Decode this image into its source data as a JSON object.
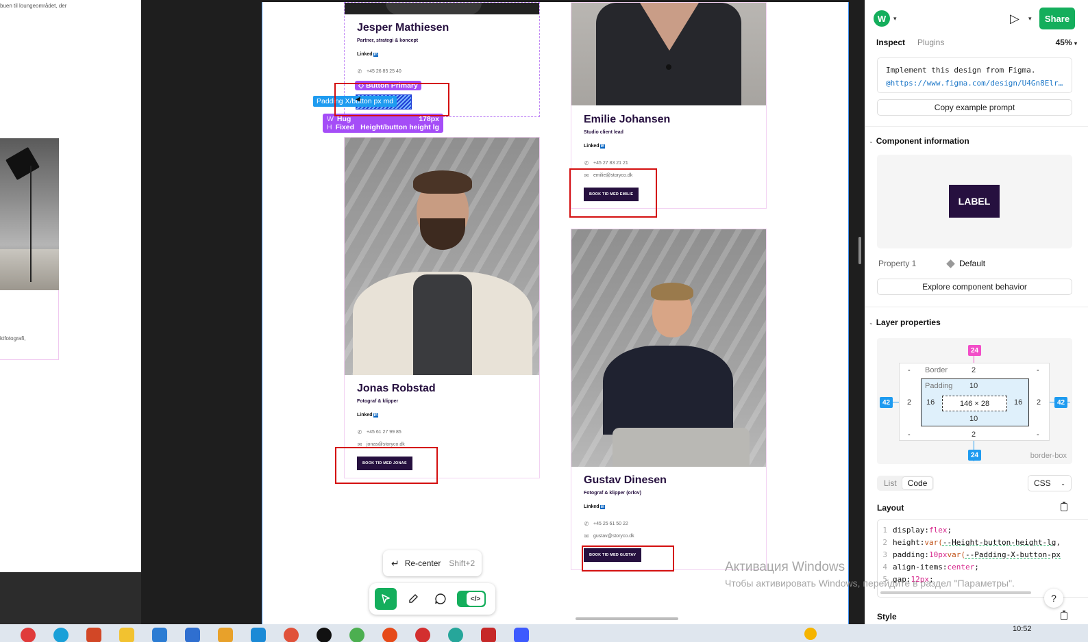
{
  "canvas": {
    "left_snippet_top": "buen til loungeområdet, der",
    "left_snippet_bottom": "ktfotografi,",
    "annotations": {
      "component_tag": "Button Primary",
      "padding_tag": "Padding X/button px md",
      "size_w_key": "W",
      "size_w_mode": "Hug",
      "size_w_value": "178px",
      "size_h_key": "H",
      "size_h_mode": "Fixed",
      "size_h_value": "Height/button height lg"
    },
    "cards": [
      {
        "name": "Jesper Mathiesen",
        "role": "Partner, strategi & koncept",
        "linkedin": "Linked",
        "linkedin_badge": "in",
        "phone": "+45 26 85 25 40",
        "email": "",
        "button": ""
      },
      {
        "name": "Emilie Johansen",
        "role": "Studio client lead",
        "linkedin": "Linked",
        "linkedin_badge": "in",
        "phone": "+45 27 83 21 21",
        "email": "emilie@storyco.dk",
        "button": "BOOK TID MED EMILIE"
      },
      {
        "name": "Jonas Robstad",
        "role": "Fotograf & klipper",
        "linkedin": "Linked",
        "linkedin_badge": "in",
        "phone": "+45 61 27 99 85",
        "email": "jonas@storyco.dk",
        "button": "BOOK TID MED JONAS"
      },
      {
        "name": "Gustav Dinesen",
        "role": "Fotograf & klipper (orlov)",
        "linkedin": "Linked",
        "linkedin_badge": "in",
        "phone": "+45 25 61 50 22",
        "email": "gustav@storyco.dk",
        "button": "BOOK TID MED GUSTAV"
      }
    ],
    "recenter": {
      "label": "Re-center",
      "shortcut": "Shift+2"
    },
    "watermark": {
      "line1": "Активация Windows",
      "line2": "Чтобы активировать Windows, перейдите в раздел \"Параметры\"."
    }
  },
  "panel": {
    "avatar_letter": "W",
    "share_label": "Share",
    "tabs": [
      {
        "label": "Inspect",
        "active": true
      },
      {
        "label": "Plugins",
        "active": false
      }
    ],
    "zoom": "45%",
    "prompt_line1": "Implement this design from Figma.",
    "prompt_line2": "@https://www.figma.com/design/U4Gn8Elr…",
    "copy_prompt_label": "Copy example prompt",
    "component_section": "Component information",
    "component_preview_label": "LABEL",
    "property_name": "Property 1",
    "property_value": "Default",
    "explore_label": "Explore component behavior",
    "layer_section": "Layer properties",
    "box_model": {
      "margin_top": "24",
      "margin_bottom": "24",
      "margin_left": "42",
      "margin_right": "42",
      "border_label": "Border",
      "border_top": "2",
      "border_bottom": "2",
      "border_left": "2",
      "border_right": "2",
      "padding_label": "Padding",
      "padding_top": "10",
      "padding_bottom": "10",
      "padding_left": "16",
      "padding_right": "16",
      "content_size": "146 × 28",
      "dash": "-",
      "box_sizing": "border-box"
    },
    "view_modes": [
      "List",
      "Code"
    ],
    "active_view": "Code",
    "language": "CSS",
    "layout_section": "Layout",
    "code_lines": [
      {
        "n": "1",
        "prop": "display: ",
        "val": "flex",
        "rest": ";"
      },
      {
        "n": "2",
        "prop": "height: ",
        "fn": "var(",
        "var": "--Height-button-height-lg",
        "rest": ","
      },
      {
        "n": "3",
        "prop": "padding: ",
        "val": "10px ",
        "fn": "var(",
        "var": "--Padding-X-button-px",
        "rest": ""
      },
      {
        "n": "4",
        "prop": "align-items: ",
        "val": "center",
        "rest": ";"
      },
      {
        "n": "5",
        "prop": "gap: ",
        "val": "12px",
        "rest": ";"
      }
    ],
    "style_section": "Style",
    "help": "?"
  },
  "taskbar": {
    "clock": "10:52"
  }
}
